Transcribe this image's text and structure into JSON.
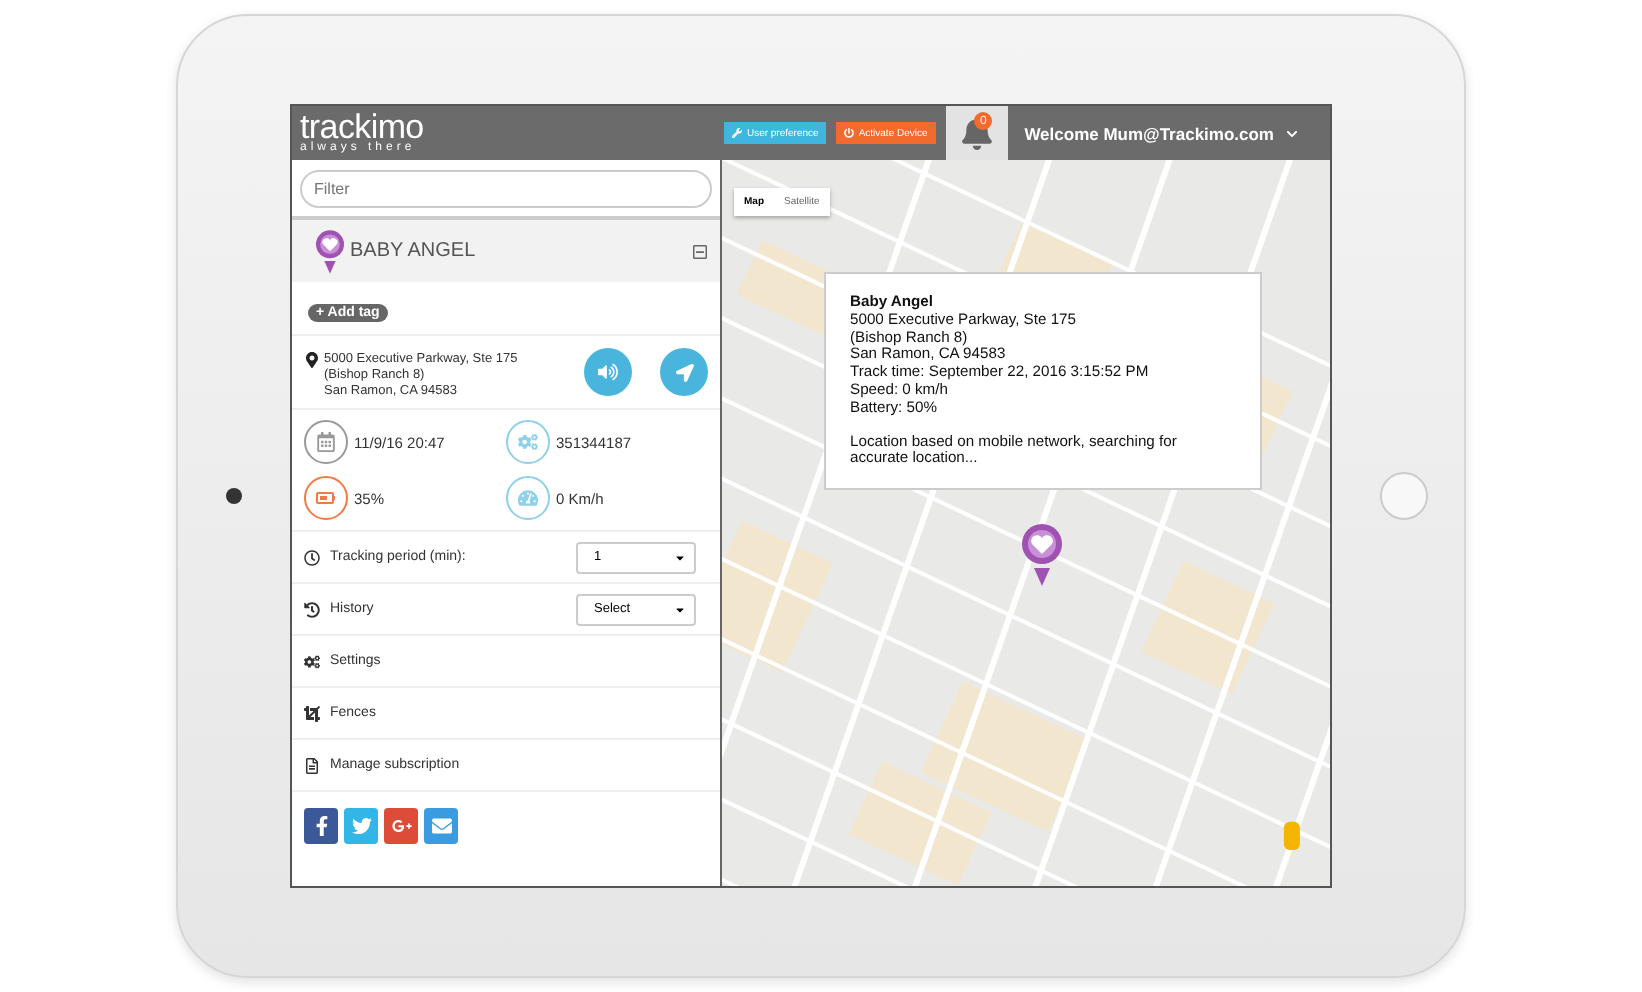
{
  "header": {
    "logo": "trackimo",
    "tagline": "always there",
    "buttons": [
      {
        "label": "User preference",
        "kind": "preferences"
      },
      {
        "label": "Activate Device",
        "kind": "activate"
      }
    ],
    "notifications": {
      "count": "0"
    },
    "user_menu": {
      "label": "Welcome Mum@Trackimo.com"
    }
  },
  "sidebar": {
    "filter": {
      "placeholder": "Filter"
    },
    "device": {
      "name": "BABY ANGEL",
      "expanded": true,
      "add_tag": "+ Add tag",
      "address": [
        "5000 Executive Parkway, Ste 175",
        "(Bishop Ranch 8)",
        "San Ramon, CA 94583"
      ],
      "stats": [
        {
          "kind": "date",
          "value": "11/9/16 20:47"
        },
        {
          "kind": "id",
          "value": "351344187"
        },
        {
          "kind": "battery",
          "value": "35%"
        },
        {
          "kind": "speed",
          "value": "0 Km/h"
        }
      ]
    },
    "menu": [
      {
        "kind": "select",
        "label": "Tracking period (min):",
        "value": "1"
      },
      {
        "kind": "select",
        "label": "History",
        "value": "Select"
      },
      {
        "kind": "link",
        "label": "Settings"
      },
      {
        "kind": "link",
        "label": "Fences"
      },
      {
        "kind": "link",
        "label": "Manage subscription"
      }
    ]
  },
  "map": {
    "view_toggle": [
      {
        "label": "Map",
        "selected": true
      },
      {
        "label": "Satellite",
        "selected": false
      }
    ],
    "popup": {
      "title": "Baby Angel",
      "lines": [
        "5000 Executive Parkway, Ste 175",
        "(Bishop Ranch 8)",
        "San Ramon, CA 94583",
        "Track time: September 22, 2016 3:15:52 PM",
        "Speed: 0 km/h",
        "Battery: 50%"
      ],
      "note": "Location based on mobile network, searching for accurate location..."
    }
  }
}
